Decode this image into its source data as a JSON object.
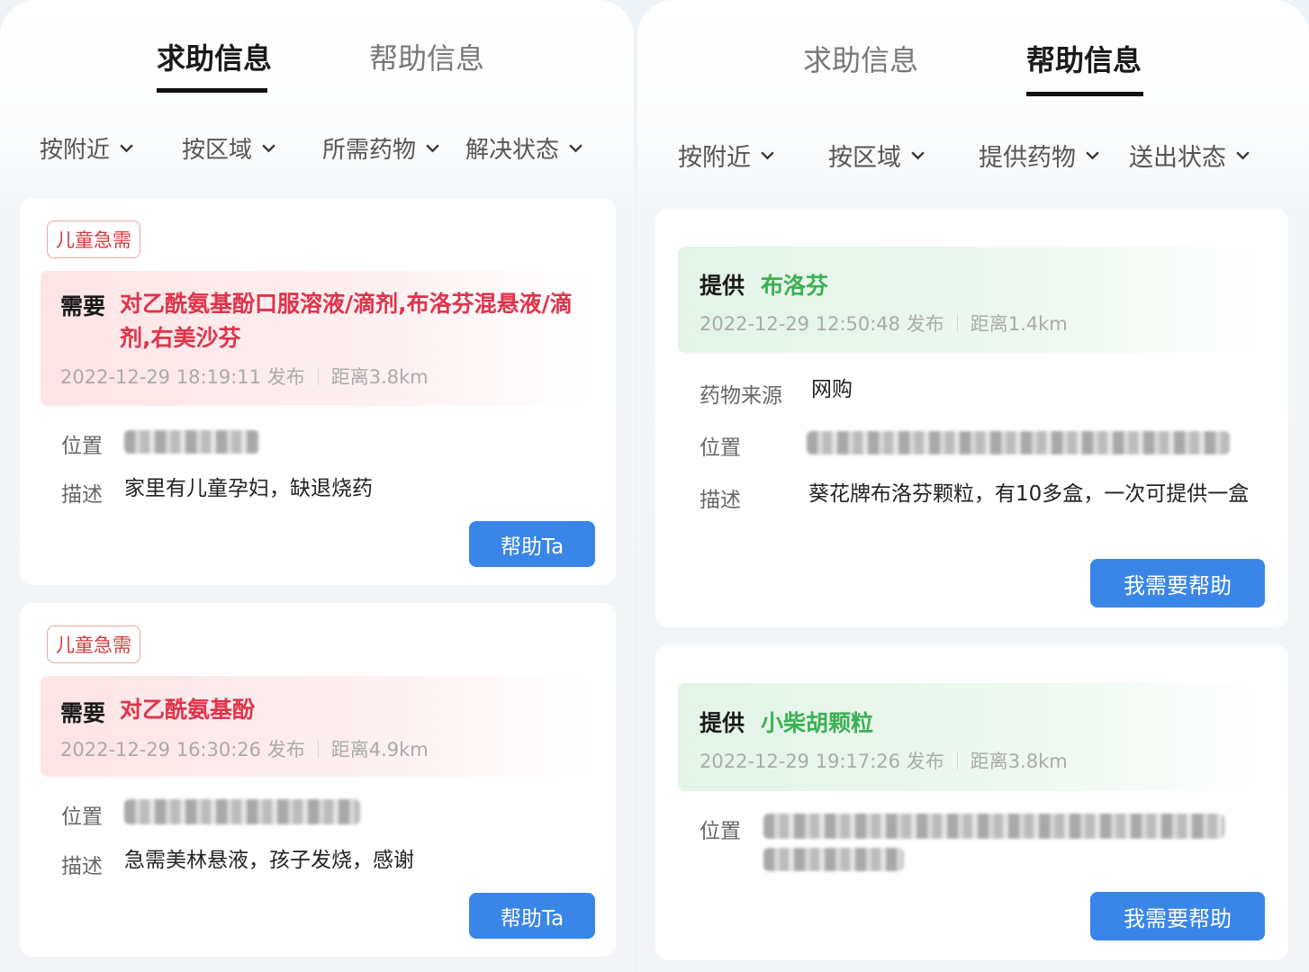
{
  "left": {
    "tabs": [
      {
        "label": "求助信息",
        "active": true
      },
      {
        "label": "帮助信息",
        "active": false
      }
    ],
    "filters": [
      "按附近",
      "按区域",
      "所需药物",
      "解决状态"
    ],
    "cards": [
      {
        "tag": "儿童急需",
        "need_label": "需要",
        "drug": "对乙酰氨基酚口服溶液/滴剂,布洛芬混悬液/滴剂,右美沙芬",
        "time": "2022-12-29 18:19:11 发布",
        "distance": "距离3.8km",
        "location_label": "位置",
        "desc_label": "描述",
        "desc": "家里有儿童孕妇，缺退烧药",
        "button": "帮助Ta"
      },
      {
        "tag": "儿童急需",
        "need_label": "需要",
        "drug": "对乙酰氨基酚",
        "time": "2022-12-29 16:30:26 发布",
        "distance": "距离4.9km",
        "location_label": "位置",
        "desc_label": "描述",
        "desc": "急需美林悬液，孩子发烧，感谢",
        "button": "帮助Ta"
      }
    ]
  },
  "right": {
    "tabs": [
      {
        "label": "求助信息",
        "active": false
      },
      {
        "label": "帮助信息",
        "active": true
      }
    ],
    "filters": [
      "按附近",
      "按区域",
      "提供药物",
      "送出状态"
    ],
    "cards": [
      {
        "offer_label": "提供",
        "drug": "布洛芬",
        "time": "2022-12-29 12:50:48 发布",
        "distance": "距离1.4km",
        "source_label": "药物来源",
        "source": "网购",
        "location_label": "位置",
        "desc_label": "描述",
        "desc": "葵花牌布洛芬颗粒，有10多盒，一次可提供一盒",
        "button": "我需要帮助"
      },
      {
        "offer_label": "提供",
        "drug": "小柴胡颗粒",
        "time": "2022-12-29 19:17:26 发布",
        "distance": "距离3.8km",
        "location_label": "位置",
        "button": "我需要帮助"
      }
    ]
  },
  "colors": {
    "accent": "#3a86e8",
    "urgent_red": "#e0334a",
    "offer_green": "#3bb154"
  },
  "icons": {
    "filter_dropdown": "chevron-down-icon"
  }
}
